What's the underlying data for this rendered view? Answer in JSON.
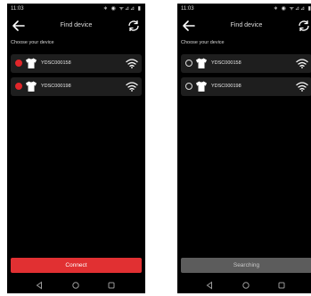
{
  "screens": [
    {
      "status": {
        "time": "11:03",
        "icons": "∗ ◉ ᯤ⊿⊿ ▮"
      },
      "app_bar": {
        "title": "Find device"
      },
      "section_label": "Choose your device",
      "devices": [
        {
          "name": "YDSC000158",
          "selected": true
        },
        {
          "name": "YDSC000198",
          "selected": true
        }
      ],
      "action_button": {
        "label": "Connect",
        "state": "enabled",
        "color": "#e13032"
      }
    },
    {
      "status": {
        "time": "11:03",
        "icons": "∗ ◉ ᯤ⊿⊿ ▮"
      },
      "app_bar": {
        "title": "Find device"
      },
      "section_label": "Choose your device",
      "devices": [
        {
          "name": "YDSC000158",
          "selected": false
        },
        {
          "name": "YDSC000198",
          "selected": false
        }
      ],
      "action_button": {
        "label": "Searching",
        "state": "disabled",
        "color": "#5c5c5c"
      }
    }
  ],
  "icons": {
    "back": "arrow-left-icon",
    "refresh": "refresh-icon",
    "device": "shirt-icon",
    "signal": "wifi-icon",
    "nav_back": "triangle-back-icon",
    "nav_home": "circle-home-icon",
    "nav_recents": "square-recents-icon"
  },
  "colors": {
    "accent": "#e13032",
    "background": "#000000",
    "row": "#1e1e1e"
  }
}
